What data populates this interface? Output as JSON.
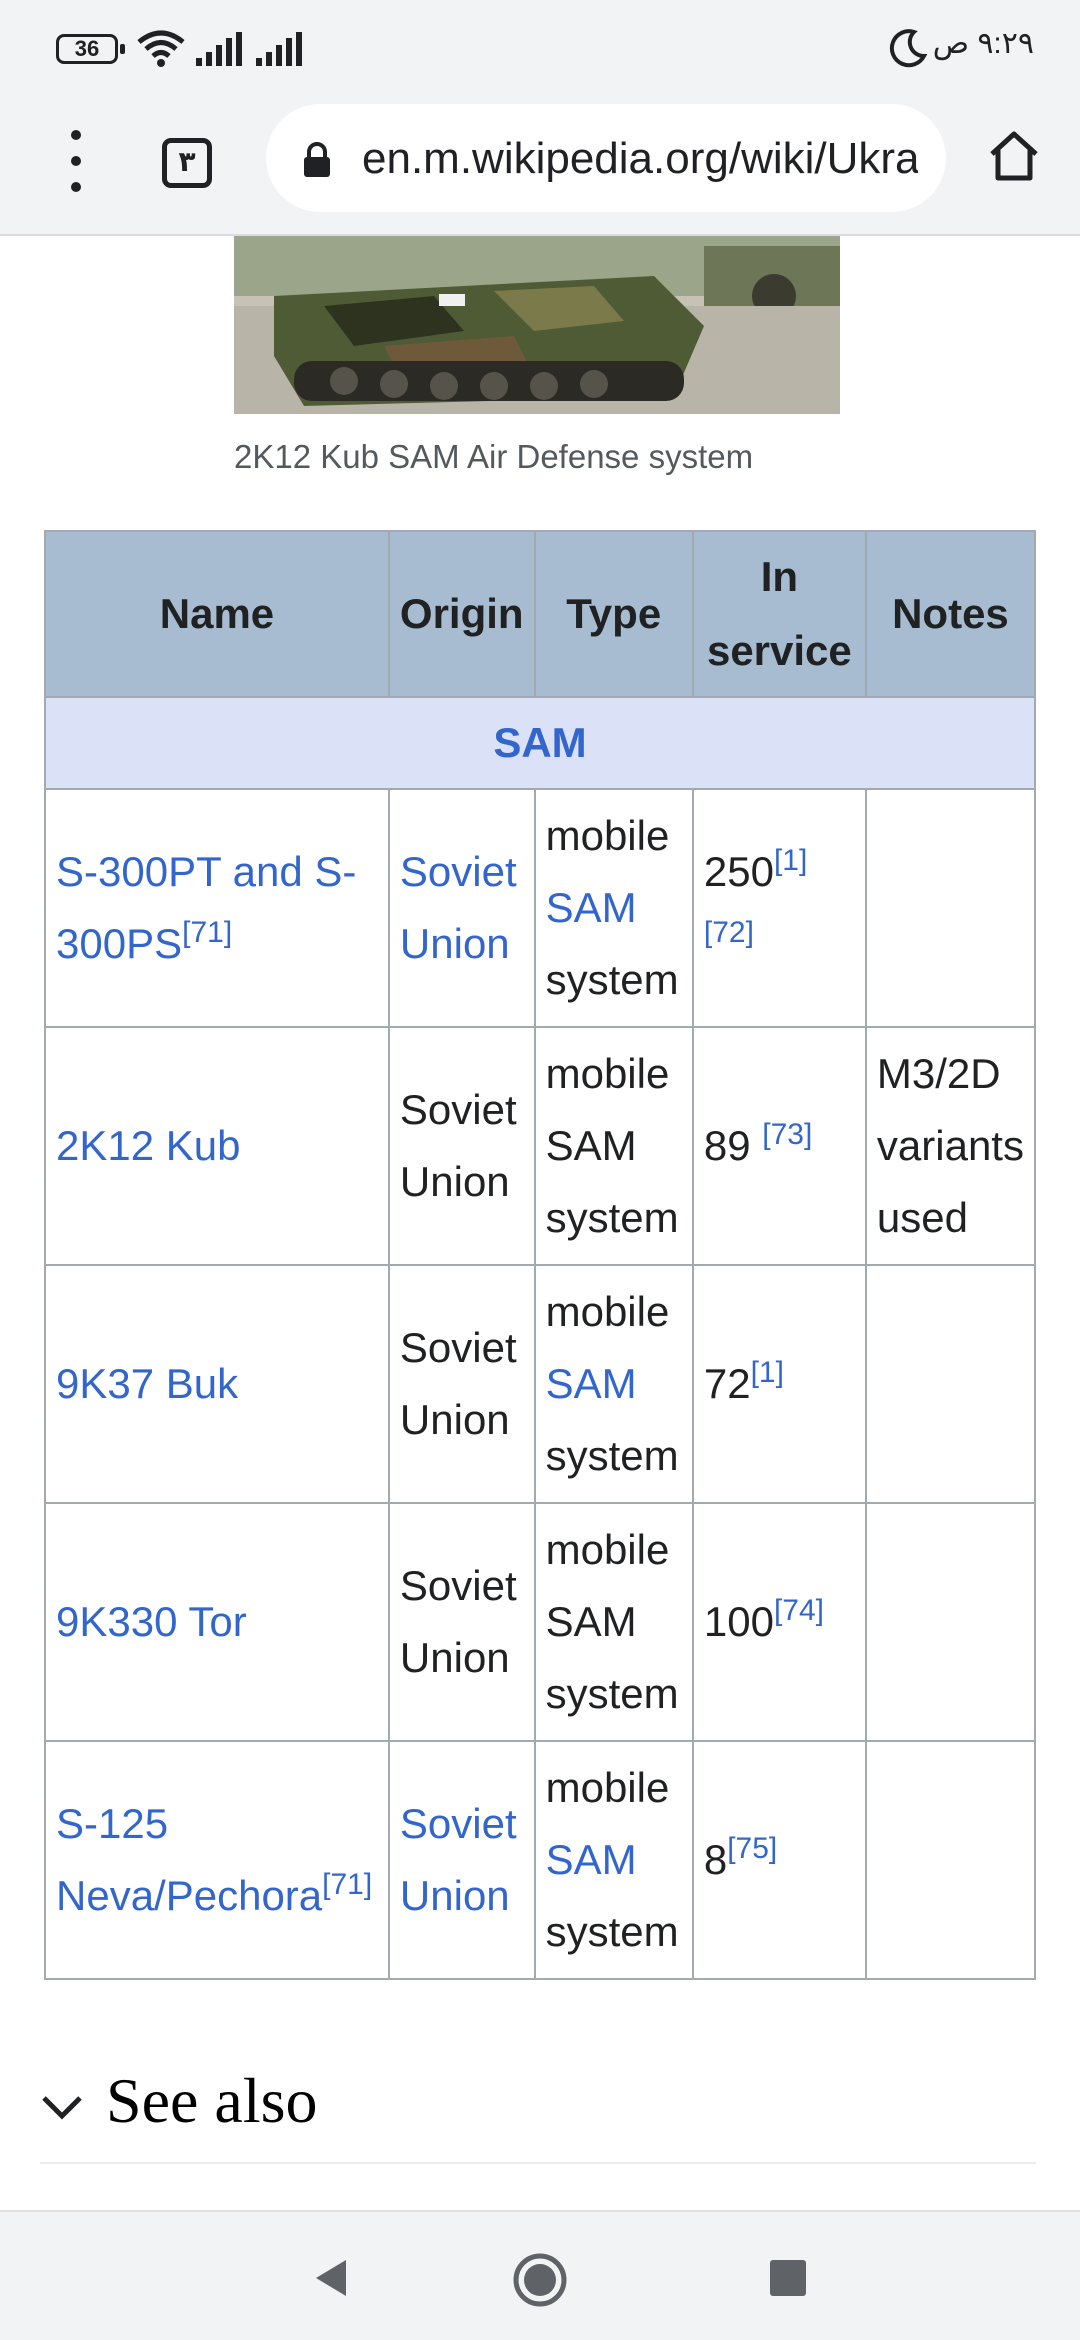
{
  "status_bar": {
    "battery": "36",
    "time": "٩:٢٩ ص"
  },
  "browser": {
    "tab_count": "٣",
    "url": "en.m.wikipedia.org/wiki/Ukra"
  },
  "figure": {
    "caption": "2K12 Kub SAM Air Defense system"
  },
  "table": {
    "headers": [
      "Name",
      "Origin",
      "Type",
      "In service",
      "Notes"
    ],
    "group_label": "SAM",
    "rows": [
      {
        "name": "S-300PT and S-300PS",
        "name_ref": "[71]",
        "origin": "Soviet Union",
        "type_top": "mobile",
        "type_mid": "SAM",
        "type_bot": "system",
        "in_service": "250",
        "refs": "[1][72]",
        "notes": ""
      },
      {
        "name": "2K12 Kub",
        "name_ref": "",
        "origin": "Soviet Union",
        "type_top": "mobile",
        "type_mid": "SAM",
        "type_bot": "system",
        "in_service": "89 ",
        "refs": "[73]",
        "notes": "M3/2D variants used"
      },
      {
        "name": "9K37 Buk",
        "name_ref": "",
        "origin": "Soviet Union",
        "type_top": "mobile",
        "type_mid": "SAM",
        "type_bot": "system",
        "in_service": "72",
        "refs": "[1]",
        "notes": ""
      },
      {
        "name": "9K330 Tor",
        "name_ref": "",
        "origin": "Soviet Union",
        "type_top": "mobile",
        "type_mid": "SAM",
        "type_bot": "system",
        "in_service": "100",
        "refs": "[74]",
        "notes": ""
      },
      {
        "name": "S-125 Neva/Pechora",
        "name_ref": "[71]",
        "origin": "Soviet Union",
        "type_top": "mobile",
        "type_mid": "SAM",
        "type_bot": "system",
        "in_service": "8",
        "refs": "[75]",
        "notes": ""
      }
    ]
  },
  "section": {
    "see_also": "See also"
  },
  "colors": {
    "link": "#3366cc",
    "header_bg": "#a7bcd1",
    "group_bg": "#dbe1f7"
  }
}
